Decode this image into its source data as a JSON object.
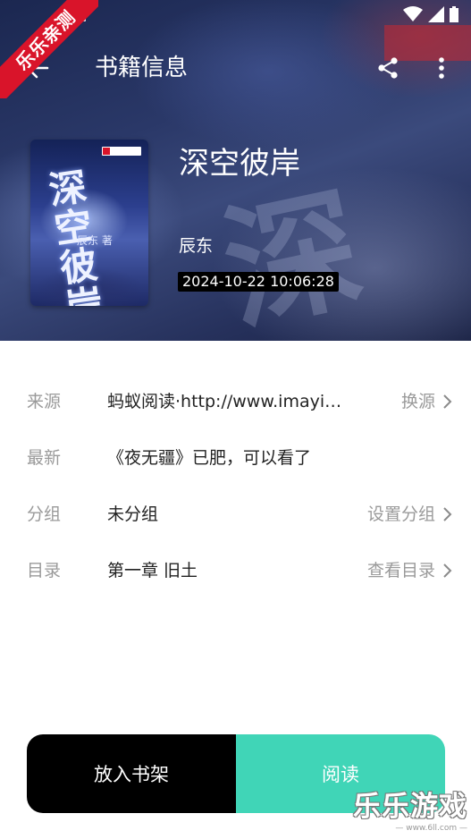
{
  "ribbon": {
    "text": "乐乐亲测"
  },
  "appbar": {
    "title": "书籍信息"
  },
  "book": {
    "name": "深空彼岸",
    "author": "辰东",
    "updated_time": "2024-10-22 10:06:28",
    "cover_title": "深空彼岸",
    "cover_author": "辰东 著"
  },
  "rows": [
    {
      "label": "来源",
      "value": "蚂蚁阅读·http://www.imayit...",
      "action": "换源"
    },
    {
      "label": "最新",
      "value": "《夜无疆》已肥，可以看了",
      "action": ""
    },
    {
      "label": "分组",
      "value": "未分组",
      "action": "设置分组"
    },
    {
      "label": "目录",
      "value": "第一章 旧土",
      "action": "查看目录"
    }
  ],
  "buttons": {
    "add_to_shelf": "放入书架",
    "read": "阅读"
  },
  "watermark": {
    "main": "乐乐游戏",
    "sub": "— www.6ll.com —"
  },
  "colors": {
    "read_button": "#40d5b7",
    "shelf_button": "#000000",
    "ribbon": "#d9142a"
  },
  "icons": [
    "back-arrow-icon",
    "share-icon",
    "more-vert-icon",
    "chevron-right-icon",
    "wifi-icon",
    "signal-icon",
    "battery-icon"
  ]
}
